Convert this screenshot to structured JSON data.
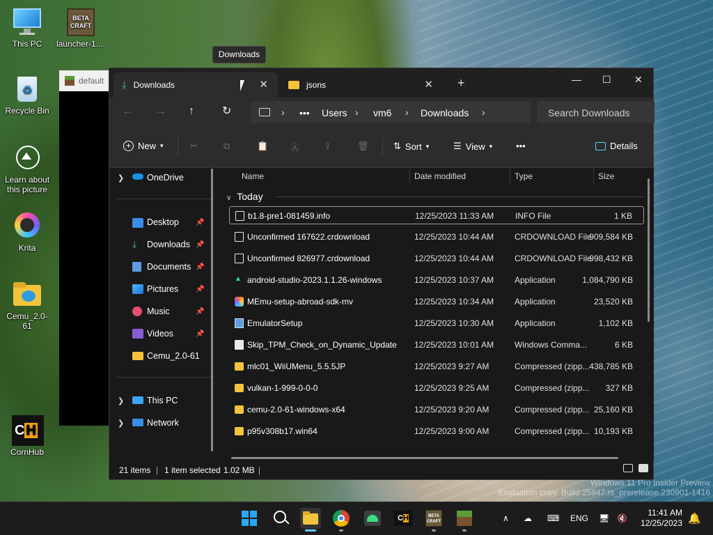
{
  "desktop": {
    "icons": [
      {
        "label": "This PC"
      },
      {
        "label": "launcher-1...."
      },
      {
        "label": "Recycle Bin"
      },
      {
        "label": "Learn about this picture"
      },
      {
        "label": "Krita"
      },
      {
        "label": "Cemu_2.0-61"
      },
      {
        "label": "CornHub"
      }
    ],
    "watermark": {
      "line1": "Windows 11 Pro Insider Preview",
      "line2": "Evaluation copy. Build 25947.rs_prerelease.230901-1416"
    }
  },
  "background_window": {
    "title": "default"
  },
  "tooltip": {
    "text": "Downloads"
  },
  "explorer": {
    "tabs": [
      {
        "label": "Downloads",
        "active": true
      },
      {
        "label": "jsons",
        "active": false
      }
    ],
    "new_tab_label": "+",
    "window_controls": {
      "minimize": "—",
      "maximize": "☐",
      "close": "✕"
    },
    "breadcrumb": [
      "Users",
      "vm6",
      "Downloads"
    ],
    "search_placeholder": "Search Downloads",
    "toolbar": {
      "new": "New",
      "sort": "Sort",
      "view": "View",
      "more": "•••",
      "details": "Details"
    },
    "sidebar": {
      "onedrive": "OneDrive",
      "quick": [
        "Desktop",
        "Downloads",
        "Documents",
        "Pictures",
        "Music",
        "Videos",
        "Cemu_2.0-61"
      ],
      "this_pc": "This PC",
      "network": "Network"
    },
    "columns": {
      "name": "Name",
      "date": "Date modified",
      "type": "Type",
      "size": "Size"
    },
    "group_label": "Today",
    "files": [
      {
        "name": "b1.8-pre1-081459.info",
        "date": "12/25/2023 11:33 AM",
        "type": "INFO File",
        "size": "1 KB",
        "icon": "file-icon"
      },
      {
        "name": "Unconfirmed 167622.crdownload",
        "date": "12/25/2023 10:44 AM",
        "type": "CRDOWNLOAD File",
        "size": "909,584 KB",
        "icon": "file-icon"
      },
      {
        "name": "Unconfirmed 826977.crdownload",
        "date": "12/25/2023 10:44 AM",
        "type": "CRDOWNLOAD File",
        "size": "998,432 KB",
        "icon": "file-icon"
      },
      {
        "name": "android-studio-2023.1.1.26-windows",
        "date": "12/25/2023 10:37 AM",
        "type": "Application",
        "size": "1,084,790 KB",
        "icon": "android-icon"
      },
      {
        "name": "MEmu-setup-abroad-sdk-mv",
        "date": "12/25/2023 10:34 AM",
        "type": "Application",
        "size": "23,520 KB",
        "icon": "memu-icon"
      },
      {
        "name": "EmulatorSetup",
        "date": "12/25/2023 10:30 AM",
        "type": "Application",
        "size": "1,102 KB",
        "icon": "setup-icon"
      },
      {
        "name": "Skip_TPM_Check_on_Dynamic_Update",
        "date": "12/25/2023 10:01 AM",
        "type": "Windows Comma...",
        "size": "6 KB",
        "icon": "script-icon"
      },
      {
        "name": "mlc01_WiiUMenu_5.5.5JP",
        "date": "12/25/2023 9:27 AM",
        "type": "Compressed (zipp...",
        "size": "438,785 KB",
        "icon": "zip-folder-icon"
      },
      {
        "name": "vulkan-1-999-0-0-0",
        "date": "12/25/2023 9:25 AM",
        "type": "Compressed (zipp...",
        "size": "327 KB",
        "icon": "zip-folder-icon"
      },
      {
        "name": "cemu-2.0-61-windows-x64",
        "date": "12/25/2023 9:20 AM",
        "type": "Compressed (zipp...",
        "size": "25,160 KB",
        "icon": "zip-folder-icon"
      },
      {
        "name": "p95v308b17.win64",
        "date": "12/25/2023 9:00 AM",
        "type": "Compressed (zipp...",
        "size": "10,193 KB",
        "icon": "zip-folder-icon"
      }
    ],
    "status": {
      "items": "21 items",
      "selected": "1 item selected",
      "size": "1.02 MB"
    }
  },
  "taskbar": {
    "language": "ENG",
    "time": "11:41 AM",
    "date": "12/25/2023",
    "apps": [
      "start-icon",
      "search-icon",
      "file-explorer-icon",
      "chrome-icon",
      "android-studio-icon",
      "cornhub-icon",
      "betacraft-icon",
      "minecraft-icon"
    ]
  }
}
